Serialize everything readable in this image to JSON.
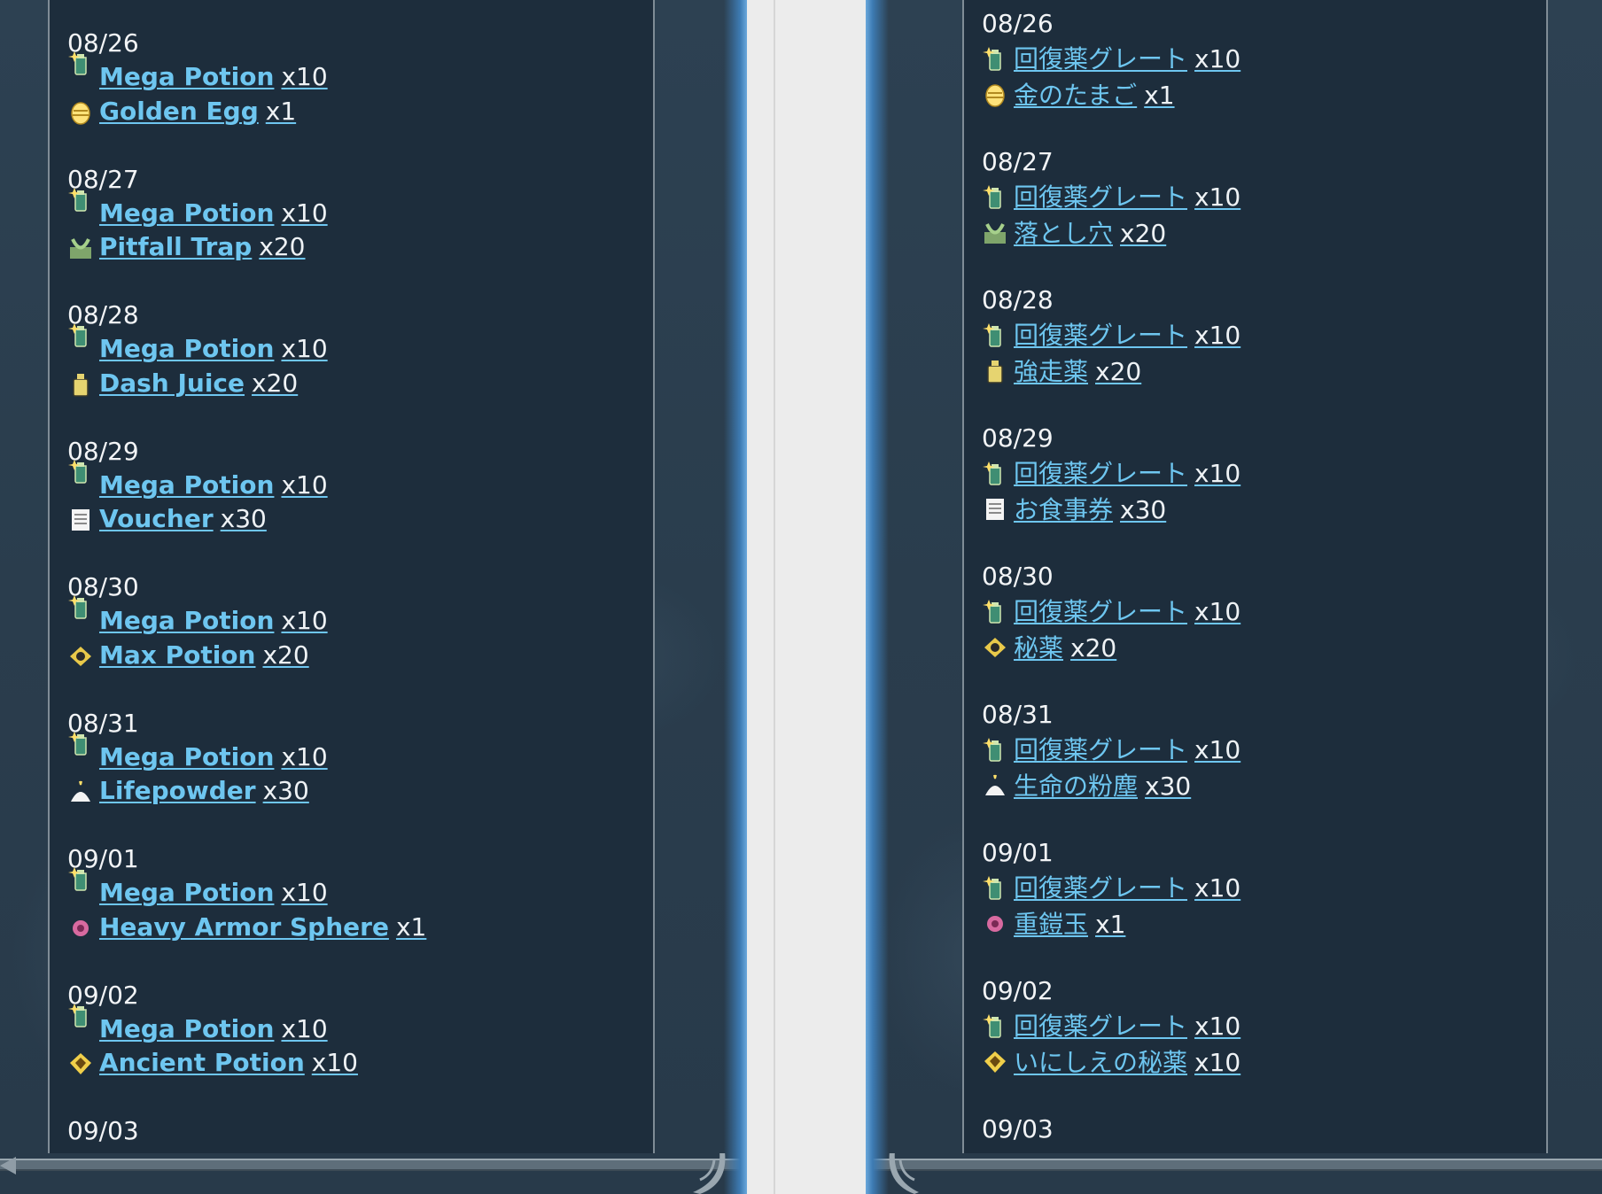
{
  "english": {
    "days": [
      {
        "date": "08/26",
        "items": [
          {
            "name": "Mega Potion",
            "qty": "x10",
            "icon": "mega-potion-icon"
          },
          {
            "name": "Golden Egg",
            "qty": "x1",
            "icon": "golden-egg-icon"
          }
        ]
      },
      {
        "date": "08/27",
        "items": [
          {
            "name": "Mega Potion",
            "qty": "x10",
            "icon": "mega-potion-icon"
          },
          {
            "name": "Pitfall Trap",
            "qty": "x20",
            "icon": "pitfall-trap-icon"
          }
        ]
      },
      {
        "date": "08/28",
        "items": [
          {
            "name": "Mega Potion",
            "qty": "x10",
            "icon": "mega-potion-icon"
          },
          {
            "name": "Dash Juice",
            "qty": "x20",
            "icon": "dash-juice-icon"
          }
        ]
      },
      {
        "date": "08/29",
        "items": [
          {
            "name": "Mega Potion",
            "qty": "x10",
            "icon": "mega-potion-icon"
          },
          {
            "name": "Voucher",
            "qty": "x30",
            "icon": "voucher-icon"
          }
        ]
      },
      {
        "date": "08/30",
        "items": [
          {
            "name": "Mega Potion",
            "qty": "x10",
            "icon": "mega-potion-icon"
          },
          {
            "name": "Max Potion",
            "qty": "x20",
            "icon": "max-potion-icon"
          }
        ]
      },
      {
        "date": "08/31",
        "items": [
          {
            "name": "Mega Potion",
            "qty": "x10",
            "icon": "mega-potion-icon"
          },
          {
            "name": "Lifepowder",
            "qty": "x30",
            "icon": "lifepowder-icon"
          }
        ]
      },
      {
        "date": "09/01",
        "items": [
          {
            "name": "Mega Potion",
            "qty": "x10",
            "icon": "mega-potion-icon"
          },
          {
            "name": "Heavy Armor Sphere",
            "qty": "x1",
            "icon": "armor-sphere-icon"
          }
        ]
      },
      {
        "date": "09/02",
        "items": [
          {
            "name": "Mega Potion",
            "qty": "x10",
            "icon": "mega-potion-icon"
          },
          {
            "name": "Ancient Potion",
            "qty": "x10",
            "icon": "ancient-potion-icon"
          }
        ]
      },
      {
        "date": "09/03",
        "items": []
      }
    ]
  },
  "japanese": {
    "days": [
      {
        "date": "08/26",
        "items": [
          {
            "name": "回復薬グレート",
            "qty": "x10",
            "icon": "mega-potion-icon"
          },
          {
            "name": "金のたまご",
            "qty": "x1",
            "icon": "golden-egg-icon"
          }
        ]
      },
      {
        "date": "08/27",
        "items": [
          {
            "name": "回復薬グレート",
            "qty": "x10",
            "icon": "mega-potion-icon"
          },
          {
            "name": "落とし穴",
            "qty": "x20",
            "icon": "pitfall-trap-icon"
          }
        ]
      },
      {
        "date": "08/28",
        "items": [
          {
            "name": "回復薬グレート",
            "qty": "x10",
            "icon": "mega-potion-icon"
          },
          {
            "name": "強走薬",
            "qty": "x20",
            "icon": "dash-juice-icon"
          }
        ]
      },
      {
        "date": "08/29",
        "items": [
          {
            "name": "回復薬グレート",
            "qty": "x10",
            "icon": "mega-potion-icon"
          },
          {
            "name": "お食事券",
            "qty": "x30",
            "icon": "voucher-icon"
          }
        ]
      },
      {
        "date": "08/30",
        "items": [
          {
            "name": "回復薬グレート",
            "qty": "x10",
            "icon": "mega-potion-icon"
          },
          {
            "name": "秘薬",
            "qty": "x20",
            "icon": "max-potion-icon"
          }
        ]
      },
      {
        "date": "08/31",
        "items": [
          {
            "name": "回復薬グレート",
            "qty": "x10",
            "icon": "mega-potion-icon"
          },
          {
            "name": "生命の粉塵",
            "qty": "x30",
            "icon": "lifepowder-icon"
          }
        ]
      },
      {
        "date": "09/01",
        "items": [
          {
            "name": "回復薬グレート",
            "qty": "x10",
            "icon": "mega-potion-icon"
          },
          {
            "name": "重鎧玉",
            "qty": "x1",
            "icon": "armor-sphere-icon"
          }
        ]
      },
      {
        "date": "09/02",
        "items": [
          {
            "name": "回復薬グレート",
            "qty": "x10",
            "icon": "mega-potion-icon"
          },
          {
            "name": "いにしえの秘薬",
            "qty": "x10",
            "icon": "ancient-potion-icon"
          }
        ]
      },
      {
        "date": "09/03",
        "items": []
      }
    ]
  },
  "colors": {
    "link": "#6ec6f0",
    "text": "#eef2f5",
    "panel": "#1d2d3c",
    "glow": "#6aa8dc"
  }
}
